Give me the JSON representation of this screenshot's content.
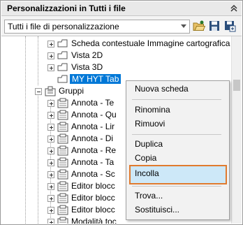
{
  "header": {
    "title": "Personalizzazioni in Tutti i file"
  },
  "toolbar": {
    "dropdown_value": "Tutti i file di personalizzazione",
    "icons": [
      "open-file-icon",
      "save-icon",
      "save-as-icon"
    ]
  },
  "tree": {
    "items": [
      {
        "label": "Scheda contestuale Immagine cartografica",
        "icon": "ribbon-tab-icon"
      },
      {
        "label": "Vista 2D",
        "icon": "ribbon-tab-icon"
      },
      {
        "label": "Vista 3D",
        "icon": "ribbon-tab-icon"
      },
      {
        "label": "MY HYT Tab",
        "icon": "ribbon-tab-icon",
        "selected": true
      },
      {
        "label": "Gruppi",
        "icon": "panels-icon"
      },
      {
        "label": "Annota - Te",
        "icon": "panel-icon"
      },
      {
        "label": "Annota - Qu",
        "icon": "panel-icon"
      },
      {
        "label": "Annota - Lir",
        "icon": "panel-icon"
      },
      {
        "label": "Annota - Di",
        "icon": "panel-icon"
      },
      {
        "label": "Annota - Re",
        "icon": "panel-icon"
      },
      {
        "label": "Annota - Ta",
        "icon": "panel-icon"
      },
      {
        "label": "Annota - Sc",
        "icon": "panel-icon"
      },
      {
        "label": "Editor blocc",
        "icon": "panel-icon"
      },
      {
        "label": "Editor blocc",
        "icon": "panel-icon"
      },
      {
        "label": "Editor blocc",
        "icon": "panel-icon"
      },
      {
        "label": "Modalità toc",
        "icon": "panel-icon"
      }
    ]
  },
  "context_menu": {
    "items": [
      {
        "label": "Nuova scheda"
      },
      {
        "label": "Rinomina"
      },
      {
        "label": "Rimuovi"
      },
      {
        "label": "Duplica"
      },
      {
        "label": "Copia"
      },
      {
        "label": "Incolla",
        "highlighted": true
      },
      {
        "label": "Trova..."
      },
      {
        "label": "Sostituisci..."
      }
    ]
  },
  "colors": {
    "selection": "#0078d7",
    "highlight_border": "#e07a2e",
    "highlight_fill": "#cde8f8"
  }
}
